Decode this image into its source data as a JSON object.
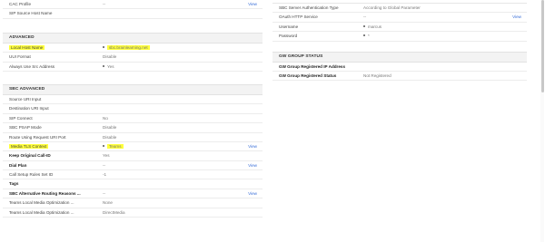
{
  "left": {
    "top_rows": [
      {
        "label": "CAC Profile",
        "value": "--",
        "view": "View"
      },
      {
        "label": "SIP Source Host Name",
        "value": ""
      }
    ],
    "advanced": {
      "title": "ADVANCED",
      "rows": [
        {
          "label": "Local Host Name",
          "value": "sbc.brainlearning.net"
        },
        {
          "label": "UUI Format",
          "value": "Disable"
        },
        {
          "label": "Always Use Src Address",
          "value": "Yes"
        }
      ]
    },
    "sbc_advanced": {
      "title": "SBC ADVANCED",
      "rows": [
        {
          "label": "Source URI Input",
          "value": ""
        },
        {
          "label": "Destination URI Input",
          "value": ""
        },
        {
          "label": "SIP Connect",
          "value": "No"
        },
        {
          "label": "SBC PSAP Mode",
          "value": "Disable"
        },
        {
          "label": "Route Using Request URI Port",
          "value": "Disable"
        },
        {
          "label": "Media TLS Context",
          "value": "Teams",
          "view": "View"
        },
        {
          "label": "Keep Original Call-ID",
          "value": "Yes"
        },
        {
          "label": "Dial Plan",
          "value": "--",
          "view": "View"
        },
        {
          "label": "Call Setup Rules Set ID",
          "value": "-1"
        },
        {
          "label": "Tags",
          "value": ""
        },
        {
          "label": "SBC Alternative Routing Reasons ...",
          "value": "--",
          "view": "View"
        },
        {
          "label": "Teams Local Media Optimization ...",
          "value": "None"
        },
        {
          "label": "Teams Local Media Optimization ...",
          "value": "DirectMedia"
        }
      ]
    }
  },
  "right": {
    "top_rows": [
      {
        "label": "SBC Server Authentication Type",
        "value": "According to Global Parameter"
      },
      {
        "label": "OAuth HTTP Service",
        "value": "--",
        "view": "View"
      },
      {
        "label": "Username",
        "value": "marcus"
      },
      {
        "label": "Password",
        "value": "*"
      }
    ],
    "gw_group_status": {
      "title": "GW GROUP STATUS",
      "rows": [
        {
          "label": "GW Group Registered IP Address",
          "value": ""
        },
        {
          "label": "GW Group Registered Status",
          "value": "Not Registered"
        }
      ]
    }
  },
  "colors": {
    "highlight": "#ffff3c",
    "link": "#3a6fd8",
    "section_bg": "#f3f3f3"
  }
}
